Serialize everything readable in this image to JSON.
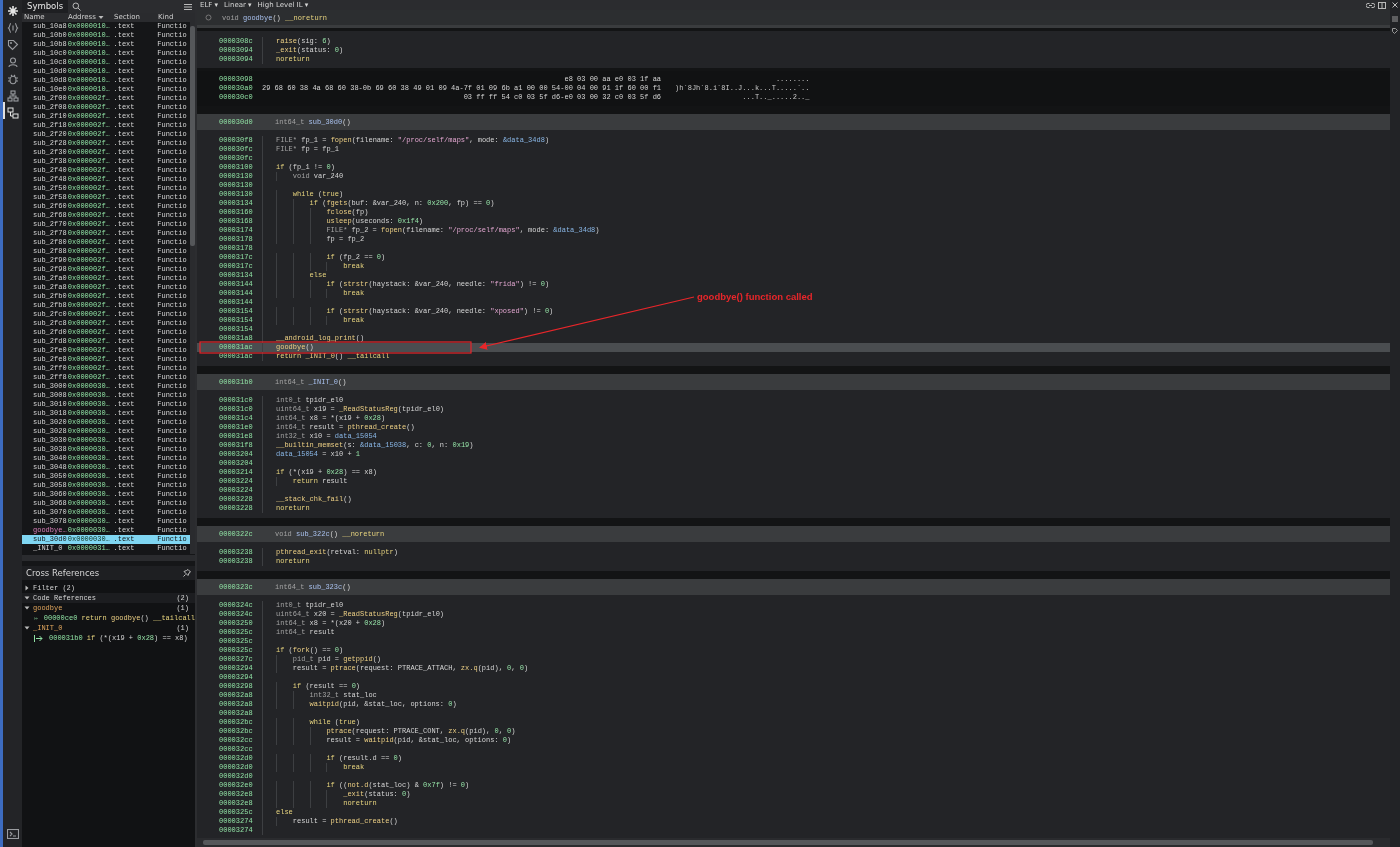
{
  "view_menus": [
    "ELF ▾",
    "Linear ▾",
    "High Level IL ▾"
  ],
  "symbols": {
    "title": "Symbols",
    "columns": [
      "Name",
      "Address",
      "Section",
      "Kind"
    ],
    "rows": [
      {
        "name": "sub_10a8",
        "address": "0x0000010…",
        "section": ".text",
        "kind": "Functio",
        "exported": false,
        "selected": false
      },
      {
        "name": "sub_10b0",
        "address": "0x0000010…",
        "section": ".text",
        "kind": "Functio",
        "exported": false,
        "selected": false
      },
      {
        "name": "sub_10b8",
        "address": "0x0000010…",
        "section": ".text",
        "kind": "Functio",
        "exported": false,
        "selected": false
      },
      {
        "name": "sub_10c0",
        "address": "0x0000010…",
        "section": ".text",
        "kind": "Functio",
        "exported": false,
        "selected": false
      },
      {
        "name": "sub_10c8",
        "address": "0x0000010…",
        "section": ".text",
        "kind": "Functio",
        "exported": false,
        "selected": false
      },
      {
        "name": "sub_10d0",
        "address": "0x0000010…",
        "section": ".text",
        "kind": "Functio",
        "exported": false,
        "selected": false
      },
      {
        "name": "sub_10d8",
        "address": "0x0000010…",
        "section": ".text",
        "kind": "Functio",
        "exported": false,
        "selected": false
      },
      {
        "name": "sub_10e0",
        "address": "0x0000010…",
        "section": ".text",
        "kind": "Functio",
        "exported": false,
        "selected": false
      },
      {
        "name": "sub_2f00",
        "address": "0x000002f…",
        "section": ".text",
        "kind": "Functio",
        "exported": false,
        "selected": false
      },
      {
        "name": "sub_2f08",
        "address": "0x000002f…",
        "section": ".text",
        "kind": "Functio",
        "exported": false,
        "selected": false
      },
      {
        "name": "sub_2f10",
        "address": "0x000002f…",
        "section": ".text",
        "kind": "Functio",
        "exported": false,
        "selected": false
      },
      {
        "name": "sub_2f18",
        "address": "0x000002f…",
        "section": ".text",
        "kind": "Functio",
        "exported": false,
        "selected": false
      },
      {
        "name": "sub_2f20",
        "address": "0x000002f…",
        "section": ".text",
        "kind": "Functio",
        "exported": false,
        "selected": false
      },
      {
        "name": "sub_2f28",
        "address": "0x000002f…",
        "section": ".text",
        "kind": "Functio",
        "exported": false,
        "selected": false
      },
      {
        "name": "sub_2f30",
        "address": "0x000002f…",
        "section": ".text",
        "kind": "Functio",
        "exported": false,
        "selected": false
      },
      {
        "name": "sub_2f38",
        "address": "0x000002f…",
        "section": ".text",
        "kind": "Functio",
        "exported": false,
        "selected": false
      },
      {
        "name": "sub_2f40",
        "address": "0x000002f…",
        "section": ".text",
        "kind": "Functio",
        "exported": false,
        "selected": false
      },
      {
        "name": "sub_2f48",
        "address": "0x000002f…",
        "section": ".text",
        "kind": "Functio",
        "exported": false,
        "selected": false
      },
      {
        "name": "sub_2f50",
        "address": "0x000002f…",
        "section": ".text",
        "kind": "Functio",
        "exported": false,
        "selected": false
      },
      {
        "name": "sub_2f58",
        "address": "0x000002f…",
        "section": ".text",
        "kind": "Functio",
        "exported": false,
        "selected": false
      },
      {
        "name": "sub_2f60",
        "address": "0x000002f…",
        "section": ".text",
        "kind": "Functio",
        "exported": false,
        "selected": false
      },
      {
        "name": "sub_2f68",
        "address": "0x000002f…",
        "section": ".text",
        "kind": "Functio",
        "exported": false,
        "selected": false
      },
      {
        "name": "sub_2f70",
        "address": "0x000002f…",
        "section": ".text",
        "kind": "Functio",
        "exported": false,
        "selected": false
      },
      {
        "name": "sub_2f78",
        "address": "0x000002f…",
        "section": ".text",
        "kind": "Functio",
        "exported": false,
        "selected": false
      },
      {
        "name": "sub_2f80",
        "address": "0x000002f…",
        "section": ".text",
        "kind": "Functio",
        "exported": false,
        "selected": false
      },
      {
        "name": "sub_2f88",
        "address": "0x000002f…",
        "section": ".text",
        "kind": "Functio",
        "exported": false,
        "selected": false
      },
      {
        "name": "sub_2f90",
        "address": "0x000002f…",
        "section": ".text",
        "kind": "Functio",
        "exported": false,
        "selected": false
      },
      {
        "name": "sub_2f98",
        "address": "0x000002f…",
        "section": ".text",
        "kind": "Functio",
        "exported": false,
        "selected": false
      },
      {
        "name": "sub_2fa0",
        "address": "0x000002f…",
        "section": ".text",
        "kind": "Functio",
        "exported": false,
        "selected": false
      },
      {
        "name": "sub_2fa8",
        "address": "0x000002f…",
        "section": ".text",
        "kind": "Functio",
        "exported": false,
        "selected": false
      },
      {
        "name": "sub_2fb0",
        "address": "0x000002f…",
        "section": ".text",
        "kind": "Functio",
        "exported": false,
        "selected": false
      },
      {
        "name": "sub_2fb8",
        "address": "0x000002f…",
        "section": ".text",
        "kind": "Functio",
        "exported": false,
        "selected": false
      },
      {
        "name": "sub_2fc0",
        "address": "0x000002f…",
        "section": ".text",
        "kind": "Functio",
        "exported": false,
        "selected": false
      },
      {
        "name": "sub_2fc8",
        "address": "0x000002f…",
        "section": ".text",
        "kind": "Functio",
        "exported": false,
        "selected": false
      },
      {
        "name": "sub_2fd0",
        "address": "0x000002f…",
        "section": ".text",
        "kind": "Functio",
        "exported": false,
        "selected": false
      },
      {
        "name": "sub_2fd8",
        "address": "0x000002f…",
        "section": ".text",
        "kind": "Functio",
        "exported": false,
        "selected": false
      },
      {
        "name": "sub_2fe0",
        "address": "0x000002f…",
        "section": ".text",
        "kind": "Functio",
        "exported": false,
        "selected": false
      },
      {
        "name": "sub_2fe8",
        "address": "0x000002f…",
        "section": ".text",
        "kind": "Functio",
        "exported": false,
        "selected": false
      },
      {
        "name": "sub_2ff0",
        "address": "0x000002f…",
        "section": ".text",
        "kind": "Functio",
        "exported": false,
        "selected": false
      },
      {
        "name": "sub_2ff8",
        "address": "0x000002f…",
        "section": ".text",
        "kind": "Functio",
        "exported": false,
        "selected": false
      },
      {
        "name": "sub_3000",
        "address": "0x0000030…",
        "section": ".text",
        "kind": "Functio",
        "exported": false,
        "selected": false
      },
      {
        "name": "sub_3008",
        "address": "0x0000030…",
        "section": ".text",
        "kind": "Functio",
        "exported": false,
        "selected": false
      },
      {
        "name": "sub_3010",
        "address": "0x0000030…",
        "section": ".text",
        "kind": "Functio",
        "exported": false,
        "selected": false
      },
      {
        "name": "sub_3018",
        "address": "0x0000030…",
        "section": ".text",
        "kind": "Functio",
        "exported": false,
        "selected": false
      },
      {
        "name": "sub_3020",
        "address": "0x0000030…",
        "section": ".text",
        "kind": "Functio",
        "exported": false,
        "selected": false
      },
      {
        "name": "sub_3028",
        "address": "0x0000030…",
        "section": ".text",
        "kind": "Functio",
        "exported": false,
        "selected": false
      },
      {
        "name": "sub_3030",
        "address": "0x0000030…",
        "section": ".text",
        "kind": "Functio",
        "exported": false,
        "selected": false
      },
      {
        "name": "sub_3038",
        "address": "0x0000030…",
        "section": ".text",
        "kind": "Functio",
        "exported": false,
        "selected": false
      },
      {
        "name": "sub_3040",
        "address": "0x0000030…",
        "section": ".text",
        "kind": "Functio",
        "exported": false,
        "selected": false
      },
      {
        "name": "sub_3048",
        "address": "0x0000030…",
        "section": ".text",
        "kind": "Functio",
        "exported": false,
        "selected": false
      },
      {
        "name": "sub_3050",
        "address": "0x0000030…",
        "section": ".text",
        "kind": "Functio",
        "exported": false,
        "selected": false
      },
      {
        "name": "sub_3058",
        "address": "0x0000030…",
        "section": ".text",
        "kind": "Functio",
        "exported": false,
        "selected": false
      },
      {
        "name": "sub_3060",
        "address": "0x0000030…",
        "section": ".text",
        "kind": "Functio",
        "exported": false,
        "selected": false
      },
      {
        "name": "sub_3068",
        "address": "0x0000030…",
        "section": ".text",
        "kind": "Functio",
        "exported": false,
        "selected": false
      },
      {
        "name": "sub_3070",
        "address": "0x0000030…",
        "section": ".text",
        "kind": "Functio",
        "exported": false,
        "selected": false
      },
      {
        "name": "sub_3078",
        "address": "0x0000030…",
        "section": ".text",
        "kind": "Functio",
        "exported": false,
        "selected": false
      },
      {
        "name": "goodbye…",
        "address": "0x0000030…",
        "section": ".text",
        "kind": "Functio",
        "exported": true,
        "selected": false
      },
      {
        "name": "sub_30d0",
        "address": "0x0000030…",
        "section": ".text",
        "kind": "Functio",
        "exported": false,
        "selected": true
      },
      {
        "name": "_INIT_0",
        "address": "0x0000031…",
        "section": ".text",
        "kind": "Functio",
        "exported": false,
        "selected": false
      }
    ]
  },
  "cross_references": {
    "title": "Cross References",
    "filter": {
      "label": "Filter (2)",
      "expanded": false
    },
    "code_references": {
      "label": "Code References",
      "count": "(2)",
      "expanded": true,
      "groups": [
        {
          "name": "goodbye",
          "count": "(1)",
          "expanded": true,
          "refs": [
            {
              "address": "00000ce0",
              "code": "return goodbye() __tailcall"
            }
          ]
        },
        {
          "name": "_INIT_0",
          "count": "(1)",
          "expanded": true,
          "refs": [
            {
              "address": "000031b0",
              "code": "if (*(x19 + 0x28) == x8)"
            }
          ]
        }
      ]
    }
  },
  "code_view": {
    "sticky_header": "void goodbye() __noreturn",
    "blocks": [
      {
        "kind": "code",
        "lines": [
          {
            "address": "0000308c",
            "code": "raise(sig: 6)",
            "selected": false
          },
          {
            "address": "00003094",
            "code": "_exit(status: 0)",
            "selected": false
          },
          {
            "address": "00003094",
            "code": "noreturn",
            "selected": false
          }
        ]
      },
      {
        "kind": "hex",
        "rows": [
          {
            "address": "00003098",
            "bytes": "e8 03 00 aa e0 03 1f aa",
            "ascii": "........"
          },
          {
            "address": "000030a0",
            "bytes": "29 68 60 38 4a 68 60 38-0b 69 60 38 49 01 09 4a-7f 01 09 6b a1 00 00 54-00 04 00 91 1f 60 00 f1",
            "ascii": ")h`8Jh`8.i`8I..J...k...T.....`.."
          },
          {
            "address": "000030c0",
            "bytes": "03 ff ff 54 c0 03 5f d6-e0 03 00 32 c0 03 5f d6",
            "ascii": "...T.._.....2.._"
          }
        ]
      },
      {
        "kind": "function",
        "address": "000030d0",
        "signature": "int64_t sub_30d0()",
        "lines": [
          {
            "address": "000030f8",
            "code": "FILE* fp_1 = fopen(filename: \"/proc/self/maps\", mode: &data_34d8)",
            "selected": false
          },
          {
            "address": "000030fc",
            "code": "FILE* fp = fp_1",
            "selected": false
          },
          {
            "address": "000030fc",
            "selected": false
          },
          {
            "address": "00003100",
            "code": "if (fp_1 != 0)",
            "selected": false
          },
          {
            "address": "00003130",
            "code": "    void var_240",
            "selected": false
          },
          {
            "address": "00003130",
            "selected": false
          },
          {
            "address": "00003130",
            "code": "    while (true)",
            "selected": false
          },
          {
            "address": "00003134",
            "code": "        if (fgets(buf: &var_240, n: 0x200, fp) == 0)",
            "selected": false
          },
          {
            "address": "00003160",
            "code": "            fclose(fp)",
            "selected": false
          },
          {
            "address": "00003168",
            "code": "            usleep(useconds: 0x1f4)",
            "selected": false
          },
          {
            "address": "00003174",
            "code": "            FILE* fp_2 = fopen(filename: \"/proc/self/maps\", mode: &data_34d8)",
            "selected": false
          },
          {
            "address": "00003178",
            "code": "            fp = fp_2",
            "selected": false
          },
          {
            "address": "00003178",
            "selected": false
          },
          {
            "address": "0000317c",
            "code": "            if (fp_2 == 0)",
            "selected": false
          },
          {
            "address": "0000317c",
            "code": "                break",
            "selected": false
          },
          {
            "address": "00003134",
            "code": "        else",
            "selected": false
          },
          {
            "address": "00003144",
            "code": "            if (strstr(haystack: &var_240, needle: \"frida\") != 0)",
            "selected": false
          },
          {
            "address": "00003144",
            "code": "                break",
            "selected": false
          },
          {
            "address": "00003144",
            "selected": false
          },
          {
            "address": "00003154",
            "code": "            if (strstr(haystack: &var_240, needle: \"xposed\") != 0)",
            "selected": false
          },
          {
            "address": "00003154",
            "code": "                break",
            "selected": false
          },
          {
            "address": "00003154",
            "selected": false
          },
          {
            "address": "000031a8",
            "code": "__android_log_print()",
            "selected": false
          },
          {
            "address": "000031ac",
            "code": "goodbye()",
            "selected": true
          },
          {
            "address": "000031ac",
            "code": "return _INIT_0() __tailcall",
            "selected": false
          }
        ]
      },
      {
        "kind": "function",
        "address": "000031b0",
        "signature": "int64_t _INIT_0()",
        "lines": [
          {
            "address": "000031c0",
            "code": "int0_t tpidr_el0",
            "selected": false
          },
          {
            "address": "000031c0",
            "code": "uint64_t x19 = _ReadStatusReg(tpidr_el0)",
            "selected": false
          },
          {
            "address": "000031c4",
            "code": "int64_t x8 = *(x19 + 0x28)",
            "selected": false
          },
          {
            "address": "000031e0",
            "code": "int64_t result = pthread_create()",
            "selected": false
          },
          {
            "address": "000031e8",
            "code": "int32_t x10 = data_15054",
            "selected": false
          },
          {
            "address": "000031f8",
            "code": "__builtin_memset(s: &data_15038, c: 0, n: 0x19)",
            "selected": false
          },
          {
            "address": "00003204",
            "code": "data_15054 = x10 + 1",
            "selected": false
          },
          {
            "address": "00003204",
            "selected": false
          },
          {
            "address": "00003214",
            "code": "if (*(x19 + 0x28) == x8)",
            "selected": false
          },
          {
            "address": "00003224",
            "code": "    return result",
            "selected": false
          },
          {
            "address": "00003224",
            "selected": false
          },
          {
            "address": "00003228",
            "code": "__stack_chk_fail()",
            "selected": false
          },
          {
            "address": "00003228",
            "code": "noreturn",
            "selected": false
          }
        ]
      },
      {
        "kind": "function",
        "address": "0000322c",
        "signature": "void sub_322c() __noreturn",
        "lines": [
          {
            "address": "00003238",
            "code": "pthread_exit(retval: nullptr)",
            "selected": false
          },
          {
            "address": "00003238",
            "code": "noreturn",
            "selected": false
          }
        ]
      },
      {
        "kind": "function",
        "address": "0000323c",
        "signature": "int64_t sub_323c()",
        "lines": [
          {
            "address": "0000324c",
            "code": "int0_t tpidr_el0",
            "selected": false
          },
          {
            "address": "0000324c",
            "code": "uint64_t x20 = _ReadStatusReg(tpidr_el0)",
            "selected": false
          },
          {
            "address": "00003250",
            "code": "int64_t x8 = *(x20 + 0x28)",
            "selected": false
          },
          {
            "address": "0000325c",
            "code": "int64_t result",
            "selected": false
          },
          {
            "address": "0000325c",
            "selected": false
          },
          {
            "address": "0000325c",
            "code": "if (fork() == 0)",
            "selected": false
          },
          {
            "address": "0000327c",
            "code": "    pid_t pid = getppid()",
            "selected": false
          },
          {
            "address": "00003294",
            "code": "    result = ptrace(request: PTRACE_ATTACH, zx.q(pid), 0, 0)",
            "selected": false
          },
          {
            "address": "00003294",
            "selected": false
          },
          {
            "address": "00003298",
            "code": "    if (result == 0)",
            "selected": false
          },
          {
            "address": "000032a8",
            "code": "        int32_t stat_loc",
            "selected": false
          },
          {
            "address": "000032a8",
            "code": "        waitpid(pid, &stat_loc, options: 0)",
            "selected": false
          },
          {
            "address": "000032a8",
            "selected": false
          },
          {
            "address": "000032bc",
            "code": "        while (true)",
            "selected": false
          },
          {
            "address": "000032bc",
            "code": "            ptrace(request: PTRACE_CONT, zx.q(pid), 0, 0)",
            "selected": false
          },
          {
            "address": "000032cc",
            "code": "            result = waitpid(pid, &stat_loc, options: 0)",
            "selected": false
          },
          {
            "address": "000032cc",
            "selected": false
          },
          {
            "address": "000032d0",
            "code": "            if (result.d == 0)",
            "selected": false
          },
          {
            "address": "000032d0",
            "code": "                break",
            "selected": false
          },
          {
            "address": "000032d0",
            "selected": false
          },
          {
            "address": "000032e0",
            "code": "            if ((not.d(stat_loc) & 0x7f) != 0)",
            "selected": false
          },
          {
            "address": "000032e8",
            "code": "                _exit(status: 0)",
            "selected": false
          },
          {
            "address": "000032e8",
            "code": "                noreturn",
            "selected": false
          },
          {
            "address": "0000325c",
            "code": "else",
            "selected": false
          },
          {
            "address": "00003274",
            "code": "    result = pthread_create()",
            "selected": false
          },
          {
            "address": "00003274",
            "selected": false
          }
        ]
      }
    ]
  },
  "annotation": {
    "text": "goodbye() function called"
  }
}
